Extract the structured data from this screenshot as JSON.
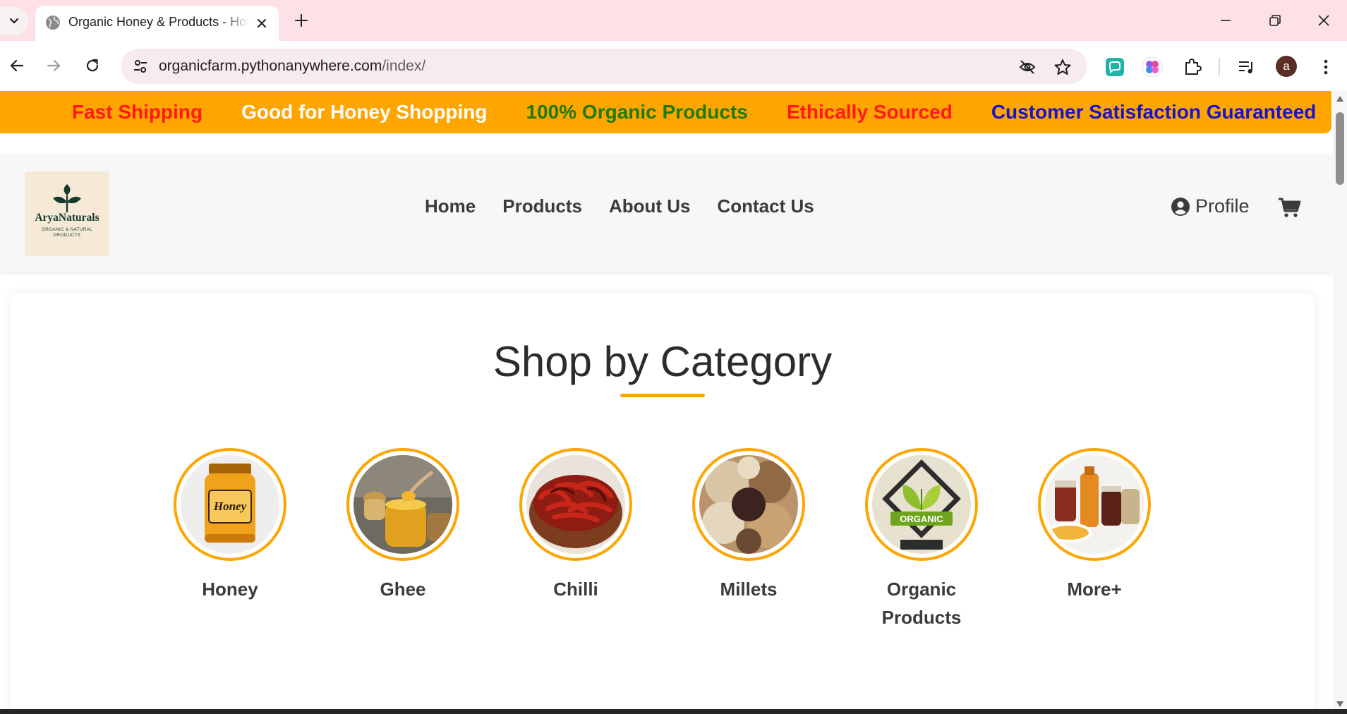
{
  "browser": {
    "tab_title": "Organic Honey & Products - Home",
    "url_domain": "organicfarm.pythonanywhere.com",
    "url_path": "/index/",
    "profile_initial": "a"
  },
  "marquee": [
    {
      "text": "Fast Shipping",
      "color": "#ff1a1a"
    },
    {
      "text": "Good for Honey Shopping",
      "color": "#ffffff"
    },
    {
      "text": "100% Organic Products",
      "color": "#1f7a0a"
    },
    {
      "text": "Ethically Sourced",
      "color": "#ff1a1a"
    },
    {
      "text": "Customer Satisfaction Guaranteed",
      "color": "#1a12c8"
    }
  ],
  "logo": {
    "name": "AryaNaturals",
    "tagline_line1": "ORGANIC & NATURAL",
    "tagline_line2": "PRODUCTS"
  },
  "nav": {
    "home": "Home",
    "products": "Products",
    "about": "About Us",
    "contact": "Contact Us",
    "profile": "Profile"
  },
  "categories_section": {
    "title": "Shop by Category",
    "accent_color": "#ffa500",
    "items": [
      {
        "label": "Honey"
      },
      {
        "label": "Ghee"
      },
      {
        "label": "Chilli"
      },
      {
        "label": "Millets"
      },
      {
        "label": "Organic Products"
      },
      {
        "label": "More+"
      }
    ]
  },
  "icons": {
    "tab_search": "chevron-down-icon",
    "tab_favicon": "globe-icon",
    "tab_close": "close-icon",
    "new_tab": "plus-icon",
    "minimize": "minimize-icon",
    "restore": "restore-icon",
    "close_window": "close-icon",
    "back": "arrow-left-icon",
    "forward": "arrow-right-icon",
    "reload": "reload-icon",
    "site_info": "tune-icon",
    "eye_off": "eye-off-icon",
    "bookmark": "star-icon",
    "extensions": "puzzle-icon",
    "media": "media-control-icon",
    "menu": "kebab-menu-icon",
    "profile": "user-circle-icon",
    "cart": "cart-icon"
  }
}
